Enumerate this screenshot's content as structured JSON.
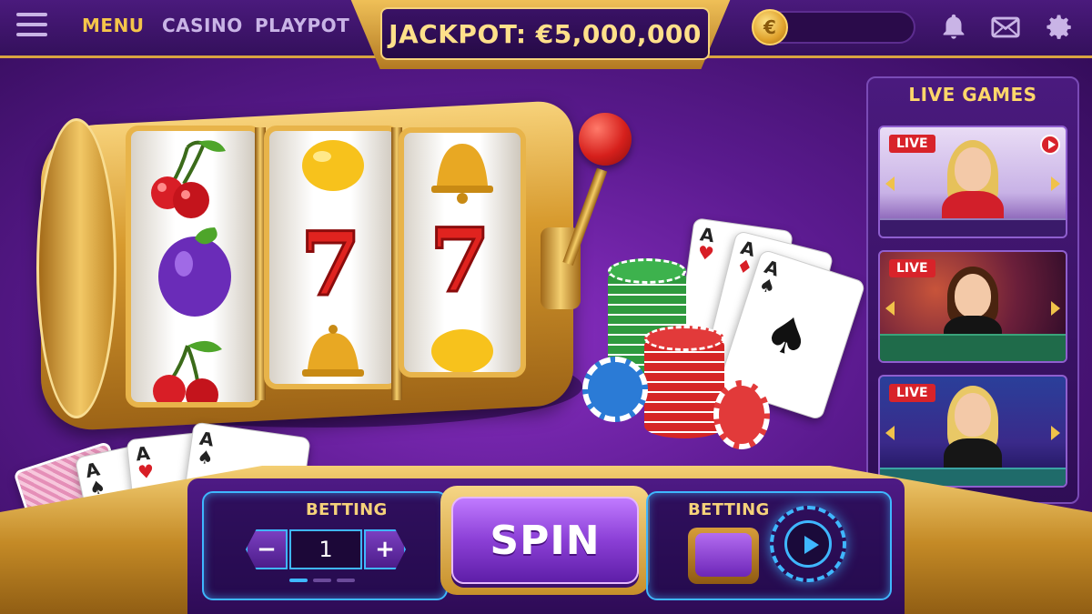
{
  "nav": {
    "menu_label": "MENU",
    "items": [
      {
        "label": "CASINO"
      },
      {
        "label": "PLAYPOT"
      }
    ]
  },
  "jackpot": {
    "text": "JACKPOT: €5,000,000"
  },
  "balance": {
    "currency_symbol": "€",
    "value": ""
  },
  "header_icons": [
    "bell-icon",
    "mail-icon",
    "gear-icon"
  ],
  "slot_machine": {
    "reels": [
      [
        "cherries",
        "plum",
        "cherries"
      ],
      [
        "lemon",
        "7",
        "bell"
      ],
      [
        "bell",
        "7",
        "lemon"
      ]
    ]
  },
  "live_games": {
    "title": "LIVE GAMES",
    "tables": [
      {
        "badge": "LIVE"
      },
      {
        "badge": "LIVE"
      },
      {
        "badge": "LIVE"
      }
    ]
  },
  "console": {
    "bet_label": "BETTING",
    "bet_value": "1",
    "minus_label": "−",
    "plus_label": "+",
    "spin_label": "SPIN",
    "second_bet_label": "BETTING"
  },
  "colors": {
    "gold": "#d9a441",
    "purple_dark": "#2e0a52",
    "neon_blue": "#3fb7ff",
    "live_red": "#d8232a"
  }
}
